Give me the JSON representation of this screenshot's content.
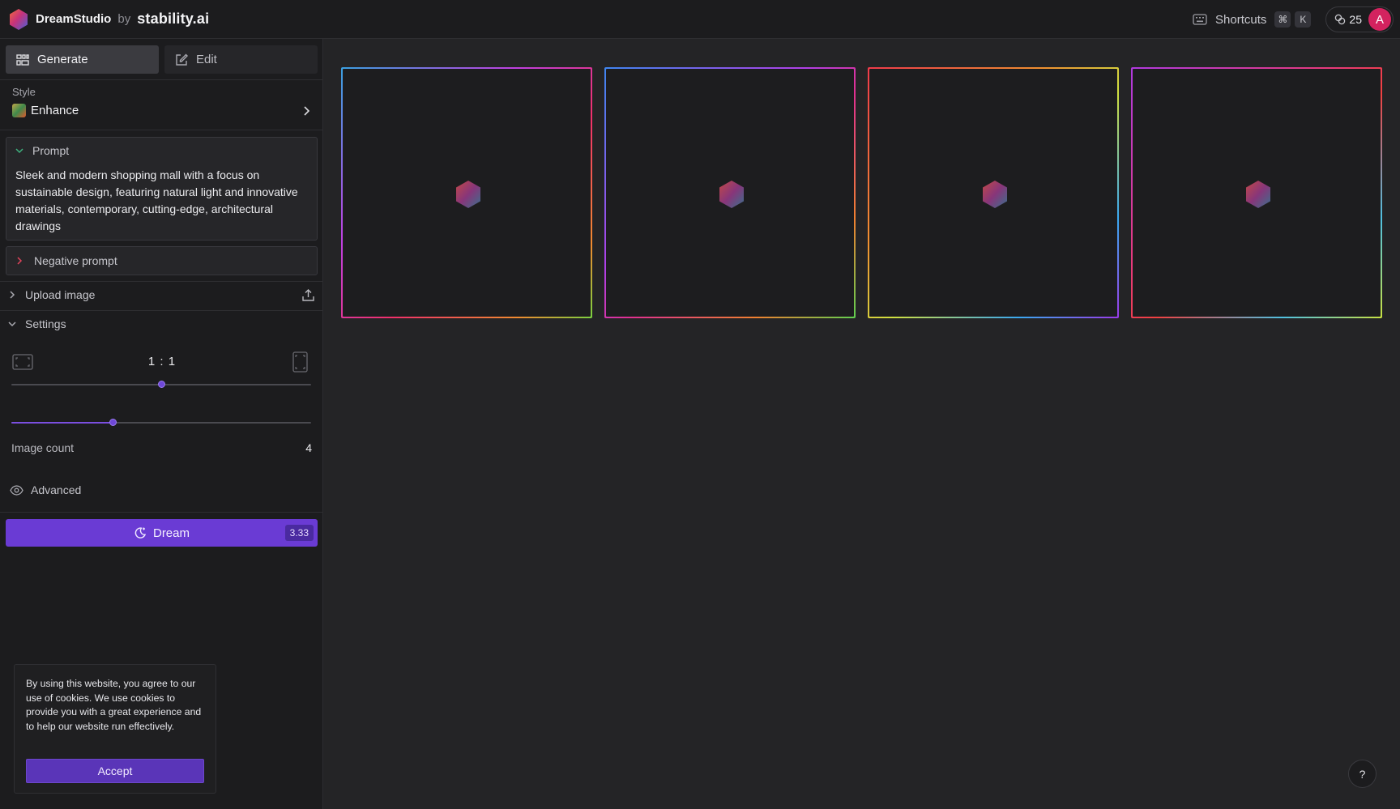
{
  "header": {
    "app_name": "DreamStudio",
    "by_text": "by",
    "company": "stability.ai",
    "shortcuts_label": "Shortcuts",
    "shortcut_keys": [
      "⌘",
      "K"
    ],
    "credits": "25",
    "avatar_initial": "A",
    "avatar_color": "#d3235f"
  },
  "sidebar": {
    "tabs": [
      {
        "label": "Generate",
        "icon": "grid-icon",
        "active": true
      },
      {
        "label": "Edit",
        "icon": "edit-icon",
        "active": false
      }
    ],
    "style": {
      "label": "Style",
      "value": "Enhance"
    },
    "prompt": {
      "label": "Prompt",
      "text": "Sleek and modern shopping mall with a focus on sustainable design, featuring natural light and innovative materials, contemporary, cutting-edge, architectural drawings"
    },
    "negative_prompt": {
      "label": "Negative prompt"
    },
    "upload_image": {
      "label": "Upload image"
    },
    "settings": {
      "label": "Settings",
      "aspect_ratio": "1 : 1",
      "aspect_ratio_position": 0.5,
      "image_count_label": "Image count",
      "image_count": "4",
      "image_count_position": 0.34
    },
    "advanced": {
      "label": "Advanced"
    },
    "dream": {
      "label": "Dream",
      "cost": "3.33"
    },
    "cookie": {
      "text": "By using this website, you agree to our use of cookies. We use cookies to provide you with a great experience and to help our website run effectively.",
      "accept_label": "Accept"
    }
  },
  "main": {
    "image_slots": [
      {
        "status": "loading"
      },
      {
        "status": "loading"
      },
      {
        "status": "loading"
      },
      {
        "status": "loading"
      }
    ]
  },
  "help": {
    "label": "?"
  },
  "colors": {
    "accent": "#6a3bd4",
    "background": "#242426",
    "sidebar": "#1c1c1e"
  }
}
